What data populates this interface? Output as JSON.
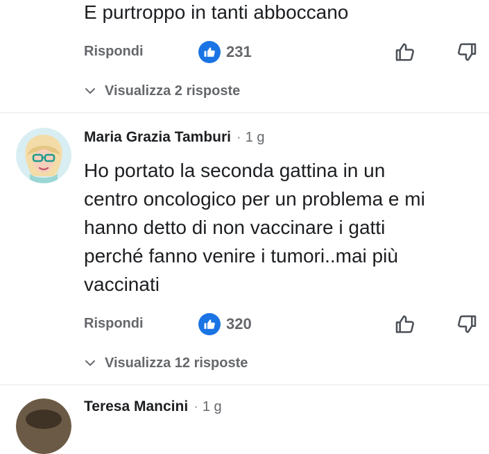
{
  "comments": [
    {
      "text": "E purtroppo in tanti abboccano",
      "reply_label": "Rispondi",
      "like_count": "231",
      "view_replies_label": "Visualizza 2 risposte"
    },
    {
      "author": "Maria Grazia Tamburi",
      "separator": "·",
      "timestamp": "1 g",
      "text_lines": [
        "Ho portato la seconda gattina in un",
        "centro oncologico per un problema e mi",
        "hanno detto di non vaccinare i gatti",
        "perché fanno venire i tumori..mai più",
        "vaccinati"
      ],
      "reply_label": "Rispondi",
      "like_count": "320",
      "view_replies_label": "Visualizza 12 risposte"
    },
    {
      "author": "Teresa Mancini",
      "separator": "·",
      "timestamp": "1 g"
    }
  ],
  "colors": {
    "text": "#1c1e21",
    "secondary": "#65676b",
    "like_blue": "#1b74e4",
    "background": "#ffffff"
  },
  "icons": {
    "like_badge": "thumbs-up-icon",
    "upvote": "thumbs-up-outline-icon",
    "downvote": "thumbs-down-outline-icon",
    "expand": "chevron-down-icon"
  }
}
